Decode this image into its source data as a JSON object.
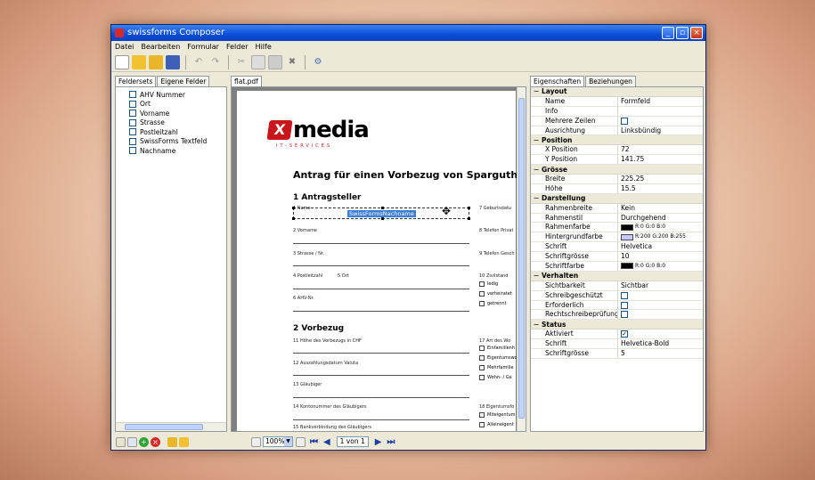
{
  "window": {
    "title": "swissforms Composer",
    "buttons": [
      "_",
      "▫",
      "×"
    ]
  },
  "menu": [
    "Datei",
    "Bearbeiten",
    "Formular",
    "Felder",
    "Hilfe"
  ],
  "left_panel": {
    "tabs": [
      "Feldersets",
      "Eigene Felder"
    ],
    "items": [
      "AHV Nummer",
      "Ort",
      "Vorname",
      "Strasse",
      "Postleitzahl",
      "SwissForms Textfeld",
      "Nachname"
    ]
  },
  "document": {
    "tab": "flat.pdf",
    "logo": {
      "mark": "X",
      "text": "media",
      "subtitle": "IT-SERVICES"
    },
    "title": "Antrag für einen Vorbezug von Sparguthaben der",
    "section1": "1 Antragsteller",
    "section2": "2 Vorbezug",
    "selected_field": "SwissFormsNachname",
    "fields": {
      "f1": "1 Name",
      "f7": "7 Geburtsdatu",
      "f2": "2 Vorname",
      "f8": "8 Telefon Privat",
      "f3": "3 Strasse / Nr.",
      "f9": "9 Telefon Gesch",
      "f4": "4 Postleitzahl",
      "f5": "5 Ort",
      "f10": "10 Zivilstand",
      "f6": "6 AHV-Nr.",
      "f11": "11 Höhe des Vorbezugs in CHF",
      "f17": "17 Art des Wo",
      "f12": "12 Auszahlungsdatum Valuta",
      "f13": "13 Gläubiger",
      "f14": "14 Kontonummer des Gläubigers",
      "f18": "18 Eigentumsfo",
      "f15": "15 Bankverbindung des Gläubigers"
    },
    "civil_options": [
      "ledig",
      "verheiratet",
      "getrennt"
    ],
    "type_options": [
      "Einfamilienh",
      "Eigentumswo",
      "Mehrfamilie",
      "Wohn- / Ge"
    ],
    "owner_options": [
      "Miteigentum",
      "Alleineigent"
    ]
  },
  "properties": {
    "tabs": [
      "Eigenschaften",
      "Beziehungen"
    ],
    "groups": [
      {
        "name": "Layout",
        "rows": [
          {
            "key": "Name",
            "value": "Formfeld"
          },
          {
            "key": "Info",
            "value": ""
          },
          {
            "key": "Mehrere Zeilen",
            "checkbox": false
          },
          {
            "key": "Ausrichtung",
            "value": "Linksbündig"
          }
        ]
      },
      {
        "name": "Position",
        "rows": [
          {
            "key": "X Position",
            "value": "72"
          },
          {
            "key": "Y Position",
            "value": "141.75"
          }
        ]
      },
      {
        "name": "Grösse",
        "rows": [
          {
            "key": "Breite",
            "value": "225.25"
          },
          {
            "key": "Höhe",
            "value": "15.5"
          }
        ]
      },
      {
        "name": "Darstellung",
        "rows": [
          {
            "key": "Rahmenbreite",
            "value": "Kein"
          },
          {
            "key": "Rahmenstil",
            "value": "Durchgehend"
          },
          {
            "key": "Rahmenfarbe",
            "color": "#000000",
            "value": "R:0 G:0 B:0"
          },
          {
            "key": "Hintergrundfarbe",
            "color": "#c8c8ff",
            "value": "R:200 G:200 B:255"
          },
          {
            "key": "Schrift",
            "value": "Helvetica"
          },
          {
            "key": "Schriftgrösse",
            "value": "10"
          },
          {
            "key": "Schriftfarbe",
            "color": "#000000",
            "value": "R:0 G:0 B:0"
          }
        ]
      },
      {
        "name": "Verhalten",
        "rows": [
          {
            "key": "Sichtbarkeit",
            "value": "Sichtbar"
          },
          {
            "key": "Schreibgeschützt",
            "checkbox": false
          },
          {
            "key": "Erforderlich",
            "checkbox": false
          },
          {
            "key": "Rechtschreibeprüfung",
            "checkbox": false
          }
        ]
      },
      {
        "name": "Status",
        "rows": [
          {
            "key": "Aktiviert",
            "checkbox": true
          },
          {
            "key": "Schrift",
            "value": "Helvetica-Bold"
          },
          {
            "key": "Schriftgrösse",
            "value": "5"
          }
        ]
      }
    ]
  },
  "bottom": {
    "zoom": "100%",
    "page": "1 von 1"
  },
  "icons": {
    "toolbar": [
      "new-document-icon",
      "open-folder-icon",
      "folder-icon",
      "save-icon",
      "undo-icon",
      "redo-icon",
      "cut-icon",
      "copy-icon",
      "paste-icon",
      "delete-icon",
      "settings-icon"
    ],
    "bottom_left": [
      "edit-icon",
      "list-icon",
      "add-icon",
      "remove-icon",
      "folder-icon",
      "folder-icon"
    ],
    "navigation": [
      "first-page-icon",
      "prev-page-icon",
      "next-page-icon",
      "last-page-icon"
    ]
  }
}
